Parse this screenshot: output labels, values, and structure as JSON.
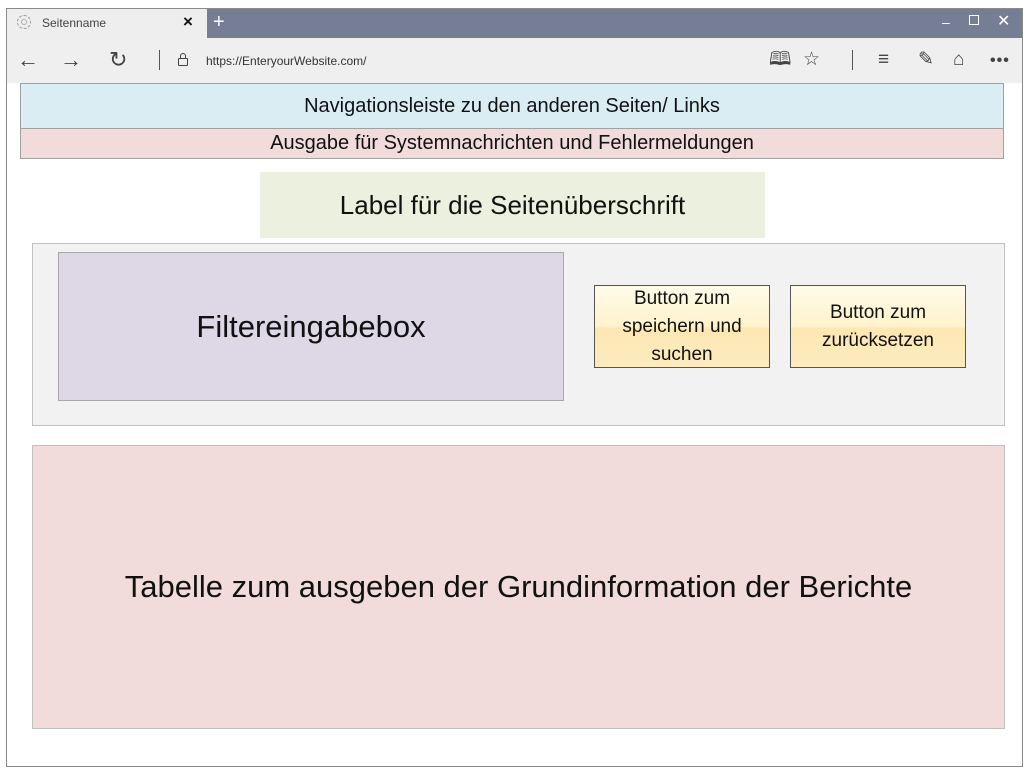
{
  "browser": {
    "tab_title": "Seitenname",
    "tab_close_icon": "×",
    "new_tab_icon": "+",
    "url": "https://EnteryourWebsite.com/",
    "window_controls": {
      "minimize_icon": "–",
      "close_icon": "✕"
    },
    "icons": {
      "back": "back-arrow-icon",
      "forward": "forward-arrow-icon",
      "refresh": "refresh-icon",
      "lock": "lock-icon",
      "reading_view": "reading-view-icon",
      "favorite": "star-icon",
      "hub": "hub-icon",
      "notes": "web-note-icon",
      "share": "share-icon",
      "more": "more-icon"
    },
    "glyphs": {
      "back": "←",
      "forward": "→",
      "refresh": "↻",
      "reading_view": "🕮",
      "favorite": "☆",
      "hub": "≡",
      "notes": "✎",
      "share": "⌂",
      "more": "•••"
    }
  },
  "page": {
    "navigation_bar": "Navigationsleiste zu den anderen Seiten/ Links",
    "system_messages": "Ausgabe für Systemnachrichten und Fehlermeldungen",
    "page_title_label": "Label für die Seitenüberschrift",
    "filter_box": "Filtereingabebox",
    "save_search_button": "Button zum speichern und suchen",
    "reset_button": "Button zum zurücksetzen",
    "reports_table": "Tabelle zum ausgeben der Grundinformation der Berichte"
  },
  "colors": {
    "tab_strip": "#767e96",
    "navigation_bar": "#daedf3",
    "system_messages": "#f2dcdb",
    "page_title_label": "#ebf1de",
    "filter_section": "#f2f2f2",
    "filter_box": "#ded8e6",
    "buttons": "#fff2cc",
    "reports_table": "#f2dcdb"
  }
}
